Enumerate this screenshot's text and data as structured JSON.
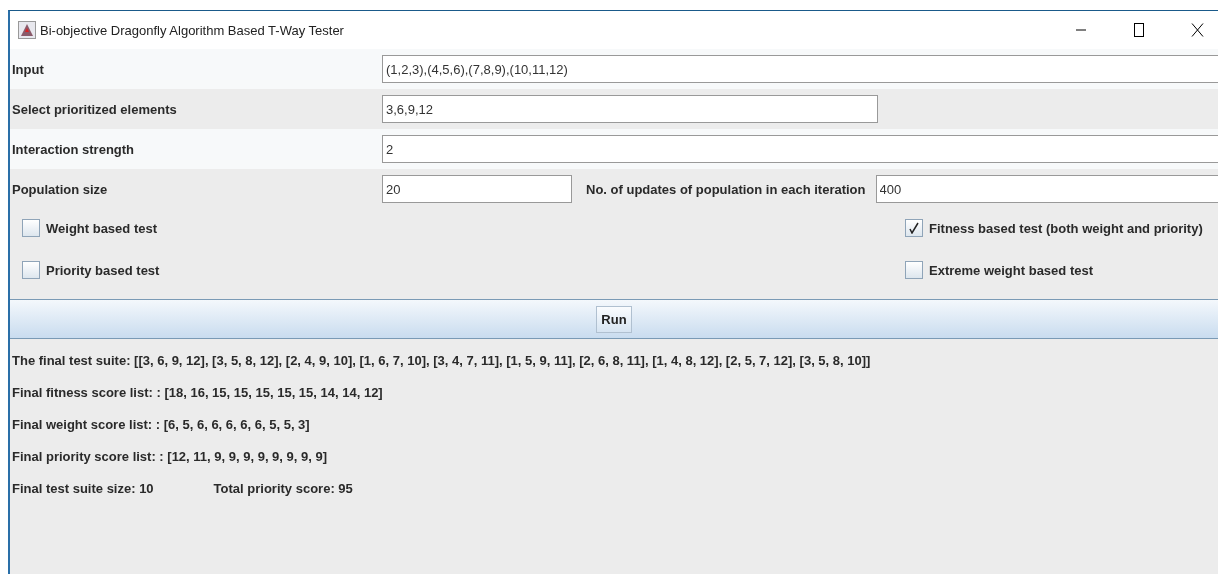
{
  "window": {
    "title": "Bi-objective Dragonfly Algorithm Based T-Way Tester"
  },
  "fields": [
    {
      "label": "Input",
      "value": "(1,2,3),(4,5,6),(7,8,9),(10,11,12)",
      "kind": "full"
    },
    {
      "label": "Select prioritized elements",
      "value": "3,6,9,12",
      "kind": "short"
    },
    {
      "label": "Interaction strength",
      "value": "2",
      "kind": "full"
    }
  ],
  "population": {
    "label": "Population size",
    "value": "20",
    "updates_label": "No. of updates of population in each iteration",
    "updates_value": "400"
  },
  "checkboxes": [
    {
      "label": "Weight based test",
      "checked": false
    },
    {
      "label": "Fitness based test (both weight and priority)",
      "checked": true
    },
    {
      "label": "Priority based test",
      "checked": false
    },
    {
      "label": "Extreme weight based test",
      "checked": false
    }
  ],
  "run_button": "Run",
  "results": [
    "The final test suite: [[3, 6, 9, 12], [3, 5, 8, 12], [2, 4, 9, 10], [1, 6, 7, 10], [3, 4, 7, 11], [1, 5, 9, 11], [2, 6, 8, 11], [1, 4, 8, 12], [2, 5, 7, 12], [3, 5, 8, 10]]",
    "Final fitness score list: : [18, 16, 15, 15, 15, 15, 15, 14, 14, 12]",
    "Final weight score list: : [6, 5, 6, 6, 6, 6, 6, 5, 5, 3]",
    "Final priority score list: : [12, 11, 9, 9, 9, 9, 9, 9, 9, 9]"
  ],
  "summary": {
    "size": "Final test suite size: 10",
    "total": "Total priority score: 95"
  }
}
